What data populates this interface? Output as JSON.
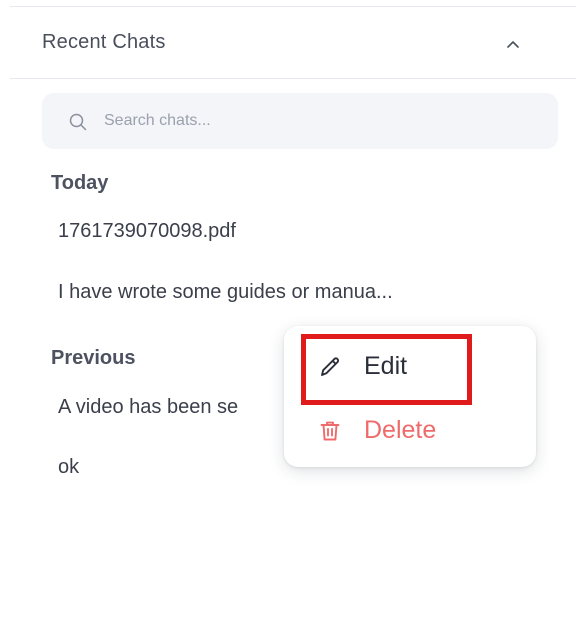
{
  "section": {
    "title": "Recent Chats",
    "collapse_icon": "chevron-up-icon"
  },
  "search": {
    "placeholder": "Search chats...",
    "value": ""
  },
  "groups": [
    {
      "label": "Today",
      "items": [
        "1761739070098.pdf",
        "I have wrote some guides or manua..."
      ]
    },
    {
      "label": "Previous",
      "items": [
        "A video has been se",
        "ok"
      ]
    }
  ],
  "context_menu": {
    "edit_label": "Edit",
    "edit_icon": "pencil-icon",
    "delete_label": "Delete",
    "delete_icon": "trash-icon",
    "delete_color": "#ef6b6b"
  },
  "highlight": {
    "target": "Edit",
    "color": "#e01b1b"
  }
}
